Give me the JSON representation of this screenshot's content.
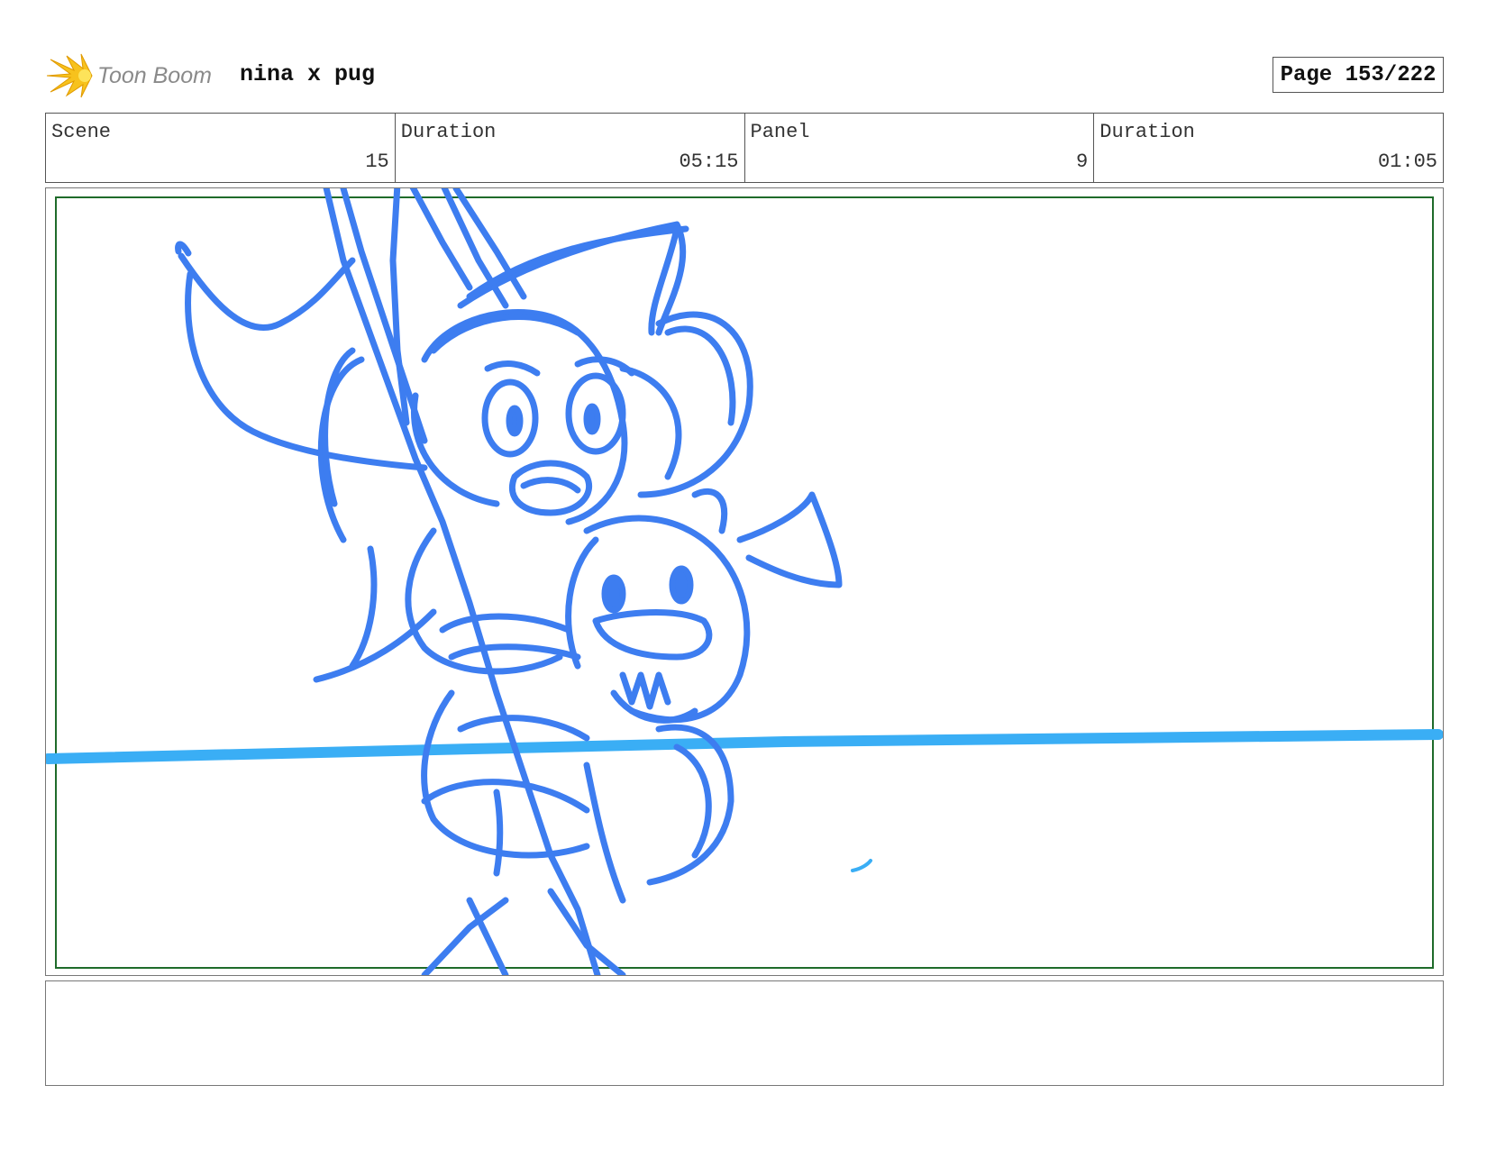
{
  "header": {
    "logo_text": "Toon Boom",
    "project_title": "nina x pug",
    "page_label": "Page 153/222"
  },
  "info": {
    "scene_label": "Scene",
    "scene_value": "15",
    "scene_duration_label": "Duration",
    "scene_duration_value": "05:15",
    "panel_label": "Panel",
    "panel_value": "9",
    "panel_duration_label": "Duration",
    "panel_duration_value": "01:05"
  },
  "panel": {
    "sketch_color": "#3d7df0",
    "horizon_color": "#3aaef5",
    "safe_frame_color": "#1f6b2a"
  },
  "notes": {
    "text": ""
  }
}
